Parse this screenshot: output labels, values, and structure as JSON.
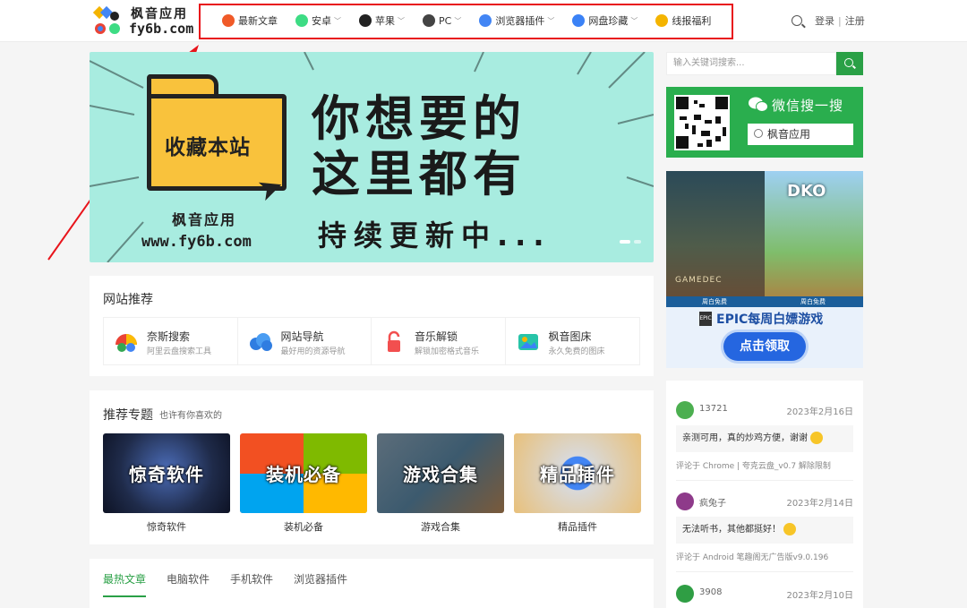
{
  "header": {
    "logo": {
      "title": "枫音应用",
      "domain": "fy6b.com"
    },
    "nav": [
      {
        "label": "最新文章",
        "icon": "fire-icon",
        "color": "#f05a28",
        "dropdown": false
      },
      {
        "label": "安卓",
        "icon": "android-icon",
        "color": "#3ddc84",
        "dropdown": true
      },
      {
        "label": "苹果",
        "icon": "apple-icon",
        "color": "#222222",
        "dropdown": true
      },
      {
        "label": "PC",
        "icon": "pc-icon",
        "color": "#444444",
        "dropdown": true
      },
      {
        "label": "浏览器插件",
        "icon": "chrome-icon",
        "color": "#4285f4",
        "dropdown": true
      },
      {
        "label": "网盘珍藏",
        "icon": "cloud-drive-icon",
        "color": "#3b82f6",
        "dropdown": true
      },
      {
        "label": "线报福利",
        "icon": "diamond-icon",
        "color": "#f4b400",
        "dropdown": false
      }
    ],
    "login": "登录",
    "register": "注册"
  },
  "banner": {
    "folder_text": "收藏本站",
    "title_line1": "你想要的",
    "title_line2": "这里都有",
    "site_name": "枫音应用",
    "site_url": "www.fy6b.com",
    "subtitle": "持续更新中..."
  },
  "recommend": {
    "title": "网站推荐",
    "items": [
      {
        "name": "奈斯搜索",
        "desc": "阿里云盘搜索工具",
        "icon": "search-engine-icon"
      },
      {
        "name": "网站导航",
        "desc": "最好用的资源导航",
        "icon": "cloud-nav-icon"
      },
      {
        "name": "音乐解锁",
        "desc": "解锁加密格式音乐",
        "icon": "lock-icon"
      },
      {
        "name": "枫音图床",
        "desc": "永久免费的图床",
        "icon": "image-host-icon"
      }
    ]
  },
  "topics": {
    "title": "推荐专题",
    "subtitle": "也许有你喜欢的",
    "items": [
      {
        "label": "惊奇软件",
        "caption": "惊奇软件",
        "bg": "#1f2b4a"
      },
      {
        "label": "装机必备",
        "caption": "装机必备",
        "bg": "#e8702a"
      },
      {
        "label": "游戏合集",
        "caption": "游戏合集",
        "bg": "#3c5a6e"
      },
      {
        "label": "精品插件",
        "caption": "精品插件",
        "bg": "#d9534f"
      }
    ]
  },
  "tabs": {
    "items": [
      "最热文章",
      "电脑软件",
      "手机软件",
      "浏览器插件"
    ],
    "active": 0
  },
  "sidebar": {
    "search_placeholder": "输入关键词搜索...",
    "wechat": {
      "title": "微信搜一搜",
      "keyword": "枫音应用"
    },
    "ad": {
      "game1": "GAMEDEC",
      "game2": "DKO",
      "bar_left": "周白免费",
      "bar_right": "周白免费",
      "epic_logo": "EPIC",
      "epic_title": "EPIC每周白嫖游戏",
      "button": "点击领取"
    },
    "comments": [
      {
        "user": "13721",
        "date": "2023年2月16日",
        "text": "亲测可用，真的炒鸡方便，谢谢",
        "emoji": true,
        "source": "评论于 Chrome | 夸克云盘_v0.7 解除限制",
        "avatar_color": "#4caf50"
      },
      {
        "user": "疯兔子",
        "date": "2023年2月14日",
        "text": "无法听书，其他都挺好！",
        "emoji": true,
        "source": "评论于 Android 笔趣阁无广告版v9.0.196",
        "avatar_color": "#8e3a8a"
      },
      {
        "user": "3908",
        "date": "2023年2月10日",
        "text": "",
        "emoji": false,
        "source": "",
        "avatar_color": "#2f9e44"
      }
    ]
  },
  "colors": {
    "accent": "#2aa046",
    "highlight_box": "#e8141b",
    "banner_bg": "#a8ece0",
    "wechat_bg": "#2aae4e"
  }
}
